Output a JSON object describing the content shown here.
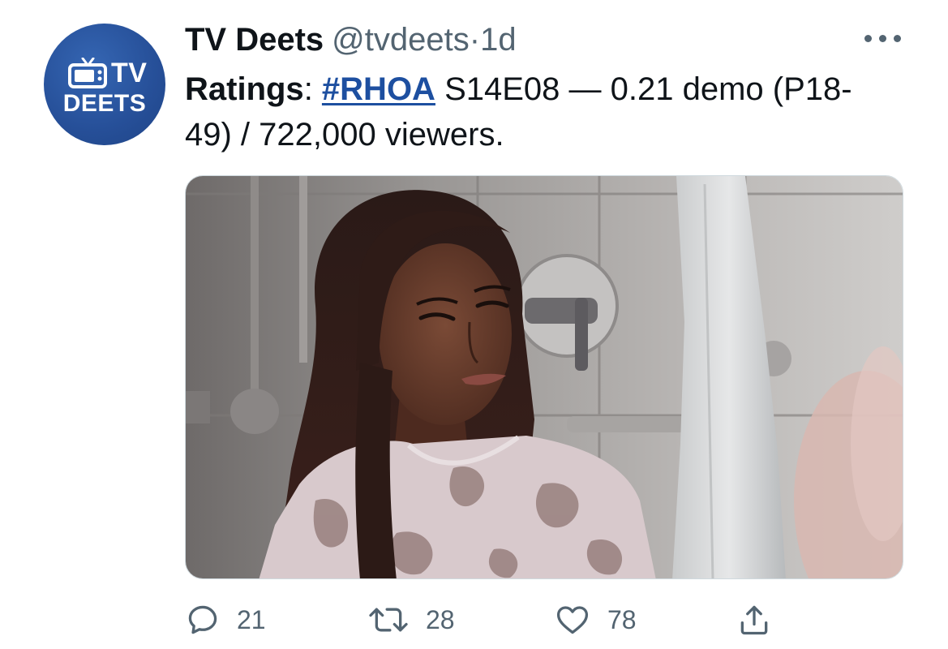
{
  "author": {
    "avatar_line1": "TV",
    "avatar_line2": "DEETS",
    "display_name": "TV Deets",
    "handle": "@tvdeets",
    "separator": "·",
    "time": "1d"
  },
  "tweet": {
    "label": "Ratings",
    "colon": ": ",
    "hashtag": "#RHOA",
    "body": " S14E08 — 0.21 demo (P18-49) / 722,000 viewers."
  },
  "actions": {
    "reply_count": "21",
    "retweet_count": "28",
    "like_count": "78"
  },
  "icons": {
    "reply": "speech-bubble-icon",
    "retweet": "retweet-icon",
    "like": "heart-icon",
    "share": "share-icon",
    "more": "more-horizontal-icon"
  },
  "colors": {
    "avatar_bg": "#264f98",
    "hashtag": "#1d4fa0",
    "secondary_text": "#536471",
    "primary_text": "#0f1419"
  }
}
